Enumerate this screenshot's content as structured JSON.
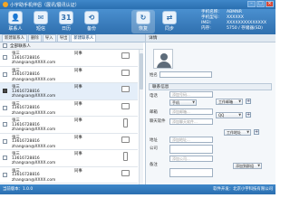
{
  "titlebar": {
    "title": "小宇助手机伴侣（展讯/展讯认证）",
    "min": "–",
    "max": "□",
    "close": "×"
  },
  "toolbar": {
    "items": [
      {
        "label": "联系人",
        "glyph": "👤"
      },
      {
        "label": "短信",
        "glyph": "✉"
      },
      {
        "label": "日历",
        "glyph": "31"
      },
      {
        "label": "备份",
        "glyph": "⟲"
      },
      {
        "label": "恢复",
        "glyph": "↻"
      },
      {
        "label": "同步",
        "glyph": "⇄"
      }
    ],
    "info": [
      {
        "k": "手机名称:",
        "v": "ABMNR"
      },
      {
        "k": "手机型号:",
        "v": "XXXXXX"
      },
      {
        "k": "IMEI:",
        "v": "XXXXXXXXXXXXXX"
      },
      {
        "k": "内存:",
        "v": "5750 / 存储器(SD)"
      }
    ]
  },
  "tabs": [
    "新建联系人",
    "删除",
    "导入",
    "导出",
    "新建联系人"
  ],
  "list": {
    "header": "全部联系人",
    "contacts": [
      {
        "name": "张三",
        "phone": "13616728816",
        "email": "zhangsan@XXXX.com",
        "group": "同事",
        "checked": false,
        "selected": false,
        "device": "sim"
      },
      {
        "name": "张三",
        "phone": "13616728816",
        "email": "zhangsan@XXXX.com",
        "group": "同事",
        "checked": false,
        "selected": false,
        "device": "sim"
      },
      {
        "name": "张三",
        "phone": "13616728816",
        "email": "zhangsan@XXXX.com",
        "group": "同事",
        "checked": true,
        "selected": true,
        "device": "sim"
      },
      {
        "name": "张三",
        "phone": "13616728816",
        "email": "zhangsan@XXXX.com",
        "group": "同事",
        "checked": false,
        "selected": false,
        "device": "sim"
      },
      {
        "name": "张三",
        "phone": "13616728816",
        "email": "zhangsan@XXXX.com",
        "group": "同事",
        "checked": false,
        "selected": false,
        "device": "phone"
      },
      {
        "name": "张三",
        "phone": "13616728816",
        "email": "zhangsan@XXXX.com",
        "group": "同事",
        "checked": false,
        "selected": false,
        "device": "sim"
      },
      {
        "name": "张三",
        "phone": "13616728816",
        "email": "zhangsan@XXXX.com",
        "group": "同事",
        "checked": false,
        "selected": false,
        "device": "phone"
      },
      {
        "name": "张三",
        "phone": "13616728816",
        "email": "zhangsan@XXXX.com",
        "group": "同事",
        "checked": false,
        "selected": false,
        "device": "sim"
      }
    ]
  },
  "detail": {
    "header": "详情",
    "name_label": "姓名",
    "info_header": "联系信息",
    "phone_label": "电话",
    "phone_placeholder": "添加号码...",
    "phone_type": "手机",
    "email_label": "邮箱",
    "email_placeholder": "添加邮箱...",
    "email_type": "工作邮箱",
    "im_label": "聊天软件",
    "im_placeholder": "添加聊天软件...",
    "im_type": "QQ",
    "address_label": "地址",
    "address_placeholder": "添加地址...",
    "address_type": "工作地址",
    "company_label": "公司",
    "company_placeholder": "添加公司...",
    "note_label": "备注",
    "group_type": "添加到群组",
    "arrow": "▼",
    "add": "+"
  },
  "status": {
    "left": "当前版本：1.0.0",
    "right": "软件开发：北京小宇科技有限公司"
  }
}
